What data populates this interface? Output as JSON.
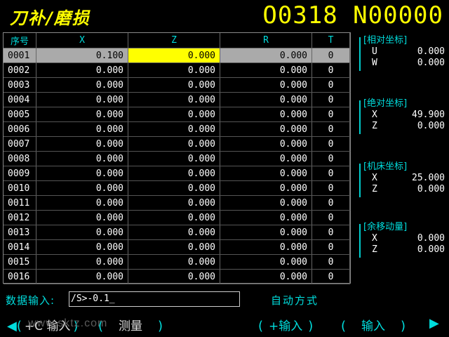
{
  "header": {
    "title": "刀补/磨损",
    "program": "O0318 N00000"
  },
  "table": {
    "columns": [
      "序号",
      "X",
      "Z",
      "R",
      "T"
    ],
    "selected_row": 0,
    "rows": [
      [
        "0001",
        "0.100",
        "0.000",
        "0.000",
        "0"
      ],
      [
        "0002",
        "0.000",
        "0.000",
        "0.000",
        "0"
      ],
      [
        "0003",
        "0.000",
        "0.000",
        "0.000",
        "0"
      ],
      [
        "0004",
        "0.000",
        "0.000",
        "0.000",
        "0"
      ],
      [
        "0005",
        "0.000",
        "0.000",
        "0.000",
        "0"
      ],
      [
        "0006",
        "0.000",
        "0.000",
        "0.000",
        "0"
      ],
      [
        "0007",
        "0.000",
        "0.000",
        "0.000",
        "0"
      ],
      [
        "0008",
        "0.000",
        "0.000",
        "0.000",
        "0"
      ],
      [
        "0009",
        "0.000",
        "0.000",
        "0.000",
        "0"
      ],
      [
        "0010",
        "0.000",
        "0.000",
        "0.000",
        "0"
      ],
      [
        "0011",
        "0.000",
        "0.000",
        "0.000",
        "0"
      ],
      [
        "0012",
        "0.000",
        "0.000",
        "0.000",
        "0"
      ],
      [
        "0013",
        "0.000",
        "0.000",
        "0.000",
        "0"
      ],
      [
        "0014",
        "0.000",
        "0.000",
        "0.000",
        "0"
      ],
      [
        "0015",
        "0.000",
        "0.000",
        "0.000",
        "0"
      ],
      [
        "0016",
        "0.000",
        "0.000",
        "0.000",
        "0"
      ]
    ]
  },
  "coords": {
    "relative": {
      "title": "[相对坐标]",
      "a1": "U",
      "v1": "0.000",
      "a2": "W",
      "v2": "0.000"
    },
    "absolute": {
      "title": "[绝对坐标]",
      "a1": "X",
      "v1": "49.900",
      "a2": "Z",
      "v2": "0.000"
    },
    "machine": {
      "title": "[机床坐标]",
      "a1": "X",
      "v1": "25.000",
      "a2": "Z",
      "v2": "0.000"
    },
    "remaining": {
      "title": "[余移动量]",
      "a1": "X",
      "v1": "0.000",
      "a2": "Z",
      "v2": "0.000"
    }
  },
  "input": {
    "label": "数据输入:",
    "value": "/S>-0.1_"
  },
  "mode": "自动方式",
  "softkeys": {
    "left_arrow": "◀",
    "k1": "+C 输入",
    "k2": "测量",
    "k3": "+输入",
    "k4": "输入",
    "right_arrow": "▶"
  },
  "watermark": "www.sktz.com",
  "colors": {
    "title": "#ffff00",
    "label": "#00dddd",
    "selected_row": "#aaaaaa",
    "cursor_cell": "#ffff00"
  }
}
